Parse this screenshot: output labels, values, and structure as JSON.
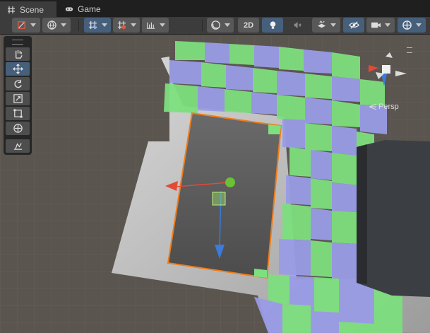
{
  "tabs": [
    {
      "label": "Scene",
      "icon": "grid-icon",
      "active": true
    },
    {
      "label": "Game",
      "icon": "gamepad-icon",
      "active": false
    }
  ],
  "toolbar": {
    "toggle_2d_label": "2D",
    "items": [
      "draw-mode-icon",
      "render-globe-icon",
      "grid-snap-icon",
      "increment-snap-icon",
      "ruler-icon",
      "shading-sphere-icon",
      "toggle-2d",
      "lighting-bulb-icon",
      "audio-mute-icon",
      "effects-icon",
      "hidden-objects-icon",
      "camera-icon",
      "gizmos-icon"
    ]
  },
  "tools": [
    {
      "name": "hand-tool",
      "icon": "hand-icon",
      "active": false
    },
    {
      "name": "move-tool",
      "icon": "move-arrows-icon",
      "active": true
    },
    {
      "name": "rotate-tool",
      "icon": "rotate-icon",
      "active": false
    },
    {
      "name": "scale-tool",
      "icon": "scale-icon",
      "active": false
    },
    {
      "name": "rect-tool",
      "icon": "rect-transform-icon",
      "active": false
    },
    {
      "name": "transform-tool",
      "icon": "transform-icon",
      "active": false
    },
    {
      "name": "custom-tool",
      "icon": "custom-editor-tool-icon",
      "active": false
    }
  ],
  "view": {
    "projection_label": "Persp",
    "colors": {
      "accent": "#46607c",
      "selection": "#f07d1c",
      "tile_green": "#7edf7e",
      "tile_blue": "#9a9ce6",
      "x_axis": "#e34a35",
      "y_axis": "#7dc53a",
      "z_axis": "#3b7bdc"
    }
  }
}
